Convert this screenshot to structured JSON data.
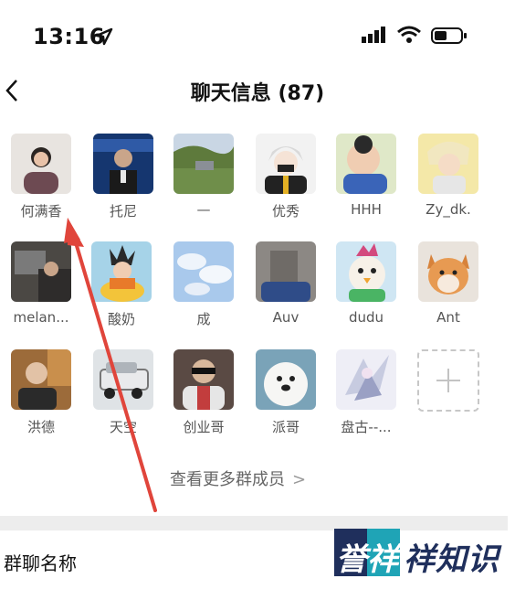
{
  "status_bar": {
    "time": "13:16"
  },
  "nav": {
    "back_icon": "chevron-left-icon",
    "title": "聊天信息 (87)"
  },
  "members": [
    {
      "name": "何满香"
    },
    {
      "name": "托尼"
    },
    {
      "name": "—"
    },
    {
      "name": "优秀"
    },
    {
      "name": "HHH"
    },
    {
      "name": "Zy_dk."
    },
    {
      "name": "melan..."
    },
    {
      "name": "酸奶"
    },
    {
      "name": "成"
    },
    {
      "name": "Auv"
    },
    {
      "name": "dudu"
    },
    {
      "name": "Ant"
    },
    {
      "name": "洪德"
    },
    {
      "name": "天空"
    },
    {
      "name": "创业哥"
    },
    {
      "name": "派哥"
    },
    {
      "name": "盘古--..."
    }
  ],
  "add_member_icon": "plus-icon",
  "view_more": {
    "label": "查看更多群成员",
    "chevron": ">"
  },
  "settings": {
    "group_name_label": "群聊名称",
    "group_name_value": "‪"
  },
  "watermark": {
    "text": "誉祥祥知识"
  },
  "colors": {
    "arrow": "#e0453b",
    "watermark_blue": "#1f2f5c",
    "watermark_teal": "#1fa4b6"
  }
}
